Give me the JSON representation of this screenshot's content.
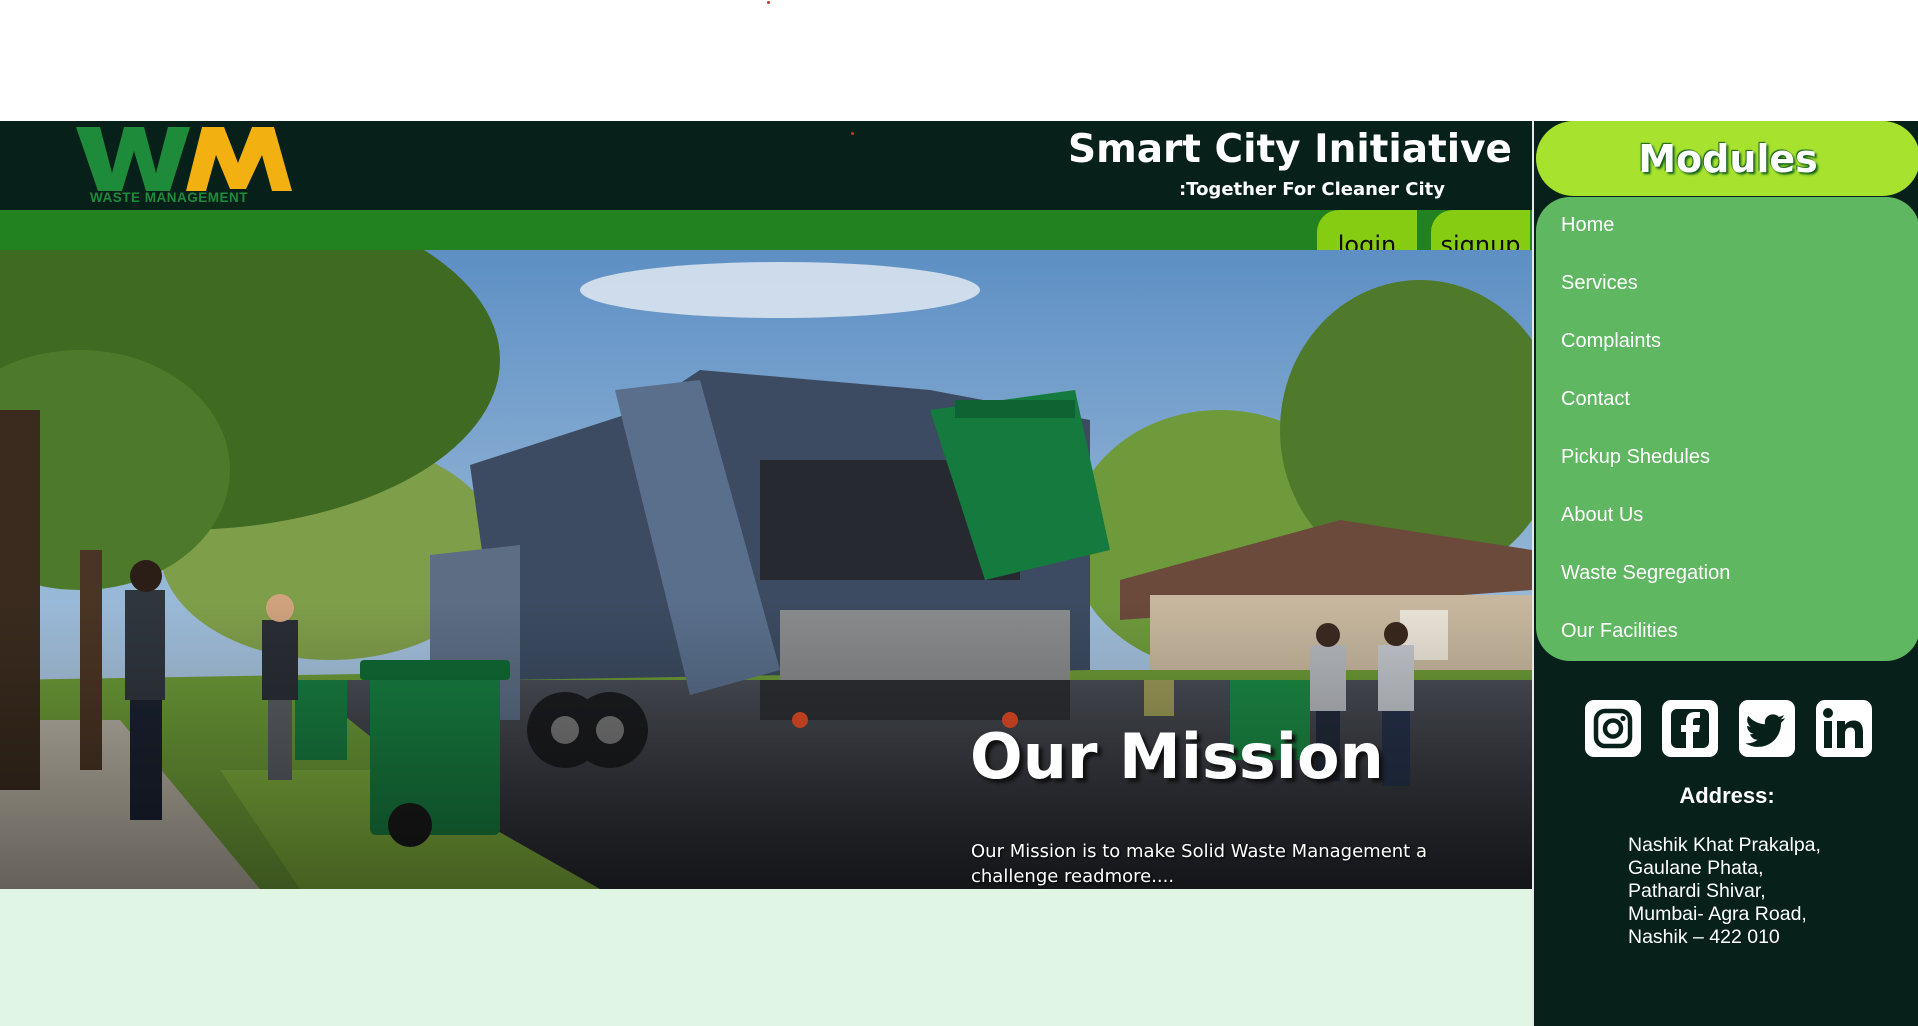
{
  "header": {
    "logo_mark": "WM",
    "logo_caption": "WASTE MANAGEMENT",
    "title": "Smart City Initiative",
    "tagline": ":Together For Cleaner City"
  },
  "auth": {
    "login_label": "login",
    "signup_label": "signup"
  },
  "hero": {
    "mission_title": "Our Mission",
    "mission_text": "Our Mission is to make Solid Waste Management a challenge readmore...."
  },
  "sidebar": {
    "modules_title": "Modules",
    "menu_items": [
      {
        "label": "Home"
      },
      {
        "label": "Services"
      },
      {
        "label": "Complaints"
      },
      {
        "label": "Contact"
      },
      {
        "label": "Pickup Shedules"
      },
      {
        "label": "About Us"
      },
      {
        "label": "Waste Segregation"
      },
      {
        "label": "Our Facilities"
      }
    ],
    "social_icons": [
      "instagram-icon",
      "facebook-icon",
      "twitter-icon",
      "linkedin-icon"
    ],
    "address_title": "Address:",
    "address_lines": [
      "Nashik Khat Prakalpa,",
      "Gaulane Phata,",
      "Pathardi Shivar,",
      "Mumbai- Agra Road,",
      "Nashik – 422 010"
    ]
  },
  "colors": {
    "header_bg": "#07201a",
    "strip_green": "#22821f",
    "button_lime": "#86cc12",
    "modules_lime": "#a6e22e",
    "menu_green": "#5fb761",
    "logo_green": "#1e8b3a",
    "logo_gold": "#f2b111",
    "mint_bg": "#e1f5e5"
  }
}
